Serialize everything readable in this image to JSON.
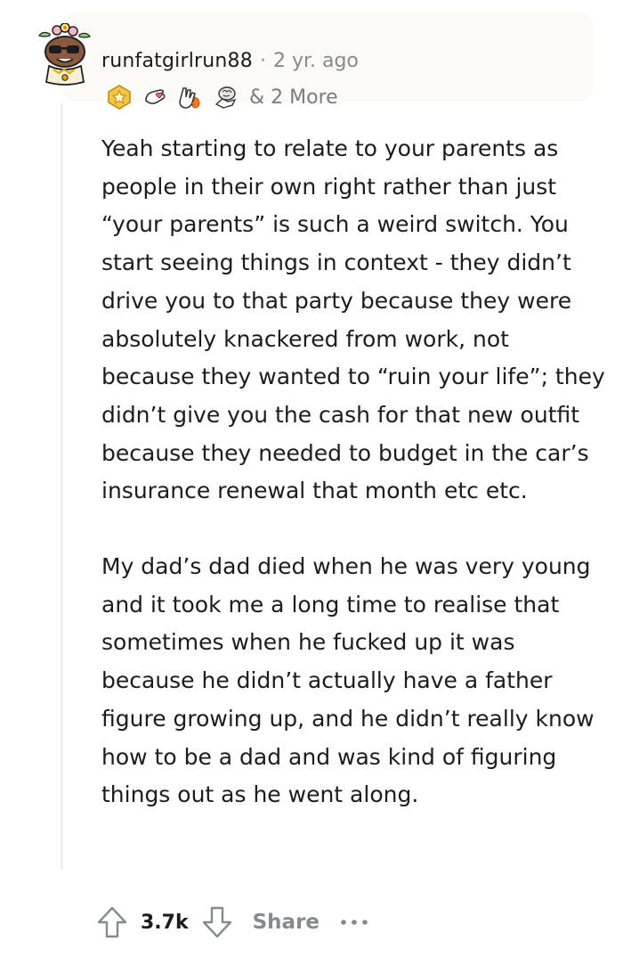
{
  "comment": {
    "username": "runfatgirlrun88",
    "separator": "·",
    "time": "2 yr. ago",
    "awards_more": "& 2 More",
    "paragraphs": [
      "Yeah starting to relate to your parents as people in their own right rather than just “your parents” is such a weird switch. You start seeing things in context - they didn’t drive you to that party because they were absolutely knackered from work, not because they wanted to “ruin your life”; they didn’t give you the cash for that new outfit because they needed to budget in the car’s insurance renewal that month etc etc.",
      "My dad’s dad died when he was very young and it took me a long time to realise that sometimes when he fucked up it was because he didn’t actually have a father figure growing up, and he didn’t really know how to be a dad and was kind of figuring things out as he went along."
    ],
    "score": "3.7k",
    "share_label": "Share",
    "awards": [
      {
        "icon": "gold-star-award-icon"
      },
      {
        "icon": "hand-heart-award-icon"
      },
      {
        "icon": "fire-hand-award-icon"
      },
      {
        "icon": "brain-hand-award-icon"
      }
    ],
    "avatar_icon": "snoo-avatar-sunglasses-icon",
    "colors": {
      "text": "#1c1c1c",
      "meta": "#878a8c",
      "header_bg": "#fbfaf4",
      "award_gold": "#f4c542"
    }
  }
}
